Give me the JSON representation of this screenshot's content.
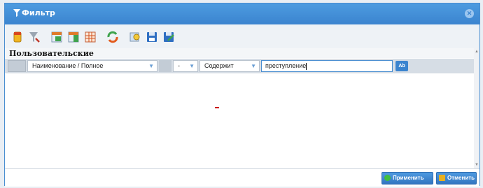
{
  "window": {
    "title": "Фильтр"
  },
  "section": {
    "title": "Пользовательские"
  },
  "filter_row": {
    "field": "Наименование / Полное",
    "negation": "-",
    "operator": "Содержит",
    "value": "преступление",
    "case_button": "Ab"
  },
  "footer": {
    "apply_label": "Применить",
    "cancel_label": "Отменить"
  },
  "colors": {
    "titlebar": "#3b84cf",
    "accent": "#4a8ed1",
    "apply_icon": "#3fbf3f",
    "cancel_icon": "#e8b020"
  },
  "toolbar_icons": [
    "clear-filter-icon",
    "filter-settings-icon",
    "add-condition-icon",
    "add-group-icon",
    "grid-remove-icon",
    "refresh-icon",
    "search-add-icon",
    "save-icon",
    "save-as-icon"
  ]
}
